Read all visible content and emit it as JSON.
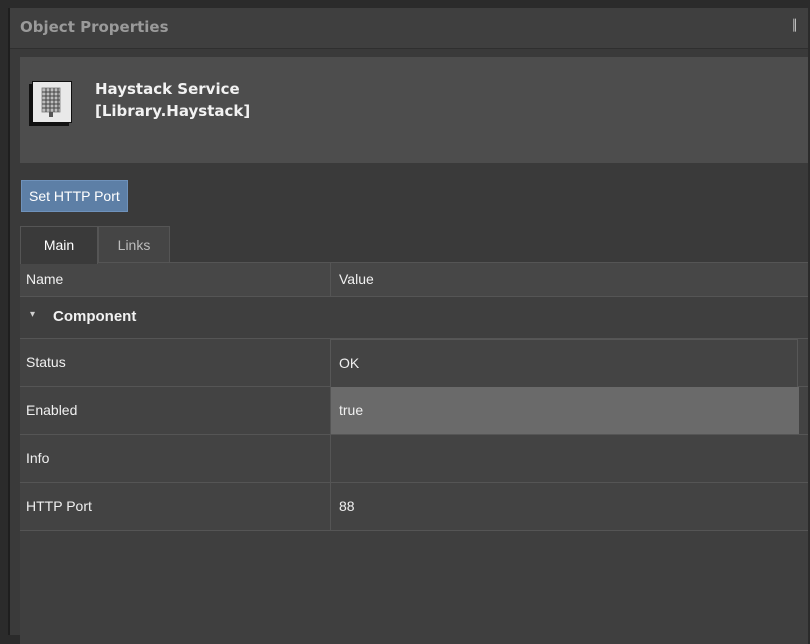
{
  "panel": {
    "title": "Object Properties",
    "pin_icon": "pin-icon",
    "pin_glyph": "║"
  },
  "object": {
    "icon": "haystack-grid-icon",
    "name": "Haystack Service",
    "path": "[Library.Haystack]"
  },
  "actions": {
    "set_port_label": "Set HTTP Port"
  },
  "tabs": [
    {
      "label": "Main",
      "active": true
    },
    {
      "label": "Links",
      "active": false
    }
  ],
  "grid": {
    "columns": {
      "name": "Name",
      "value": "Value"
    },
    "group": {
      "label": "Component",
      "expanded": true,
      "toggle_glyph": "▾"
    },
    "rows": [
      {
        "name": "Status",
        "value": "OK"
      },
      {
        "name": "Enabled",
        "value": "true"
      },
      {
        "name": "Info",
        "value": ""
      },
      {
        "name": "HTTP Port",
        "value": "88"
      }
    ]
  },
  "colors": {
    "accent_button": "#5d7fa6",
    "panel_bg": "#3a3a3a",
    "selected_value_bg": "#6a6a6a"
  }
}
